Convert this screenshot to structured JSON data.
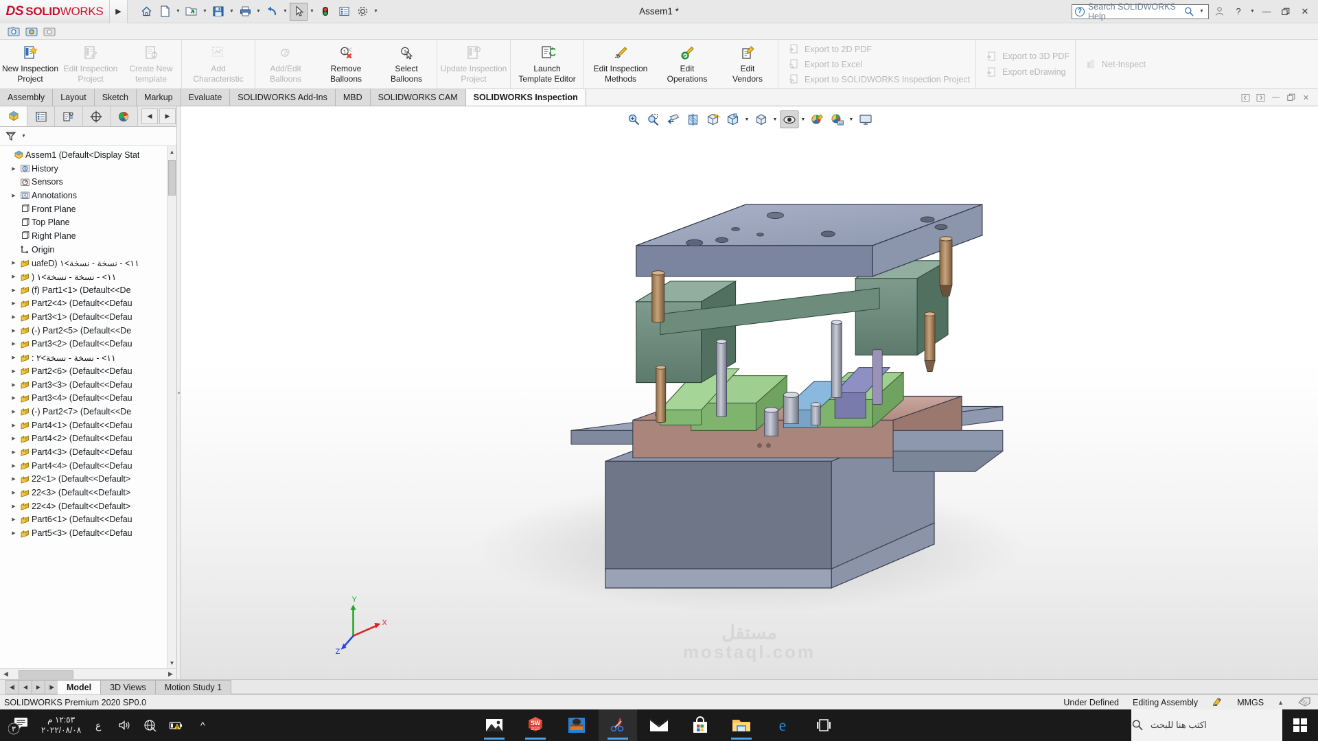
{
  "titlebar": {
    "brand_ds": "DS",
    "brand_solid": "SOLID",
    "brand_works": "WORKS",
    "document_title": "Assem1 *",
    "search_placeholder": "Search SOLIDWORKS Help",
    "tools": [
      "home-icon",
      "new-document-icon",
      "open-folder-icon",
      "save-icon",
      "print-icon",
      "undo-icon",
      "select-cursor-icon",
      "rebuild-icon",
      "options-list-icon",
      "settings-gear-icon"
    ],
    "window_buttons": [
      "account-icon",
      "help-icon",
      "minimize",
      "restore",
      "close"
    ]
  },
  "ribbon": {
    "groups": [
      {
        "buttons": [
          {
            "label_line1": "New Inspection",
            "label_line2": "Project",
            "icon": "new-inspection-project-icon",
            "disabled": false
          },
          {
            "label_line1": "Edit Inspection",
            "label_line2": "Project",
            "icon": "edit-inspection-project-icon",
            "disabled": true
          },
          {
            "label_line1": "Create New",
            "label_line2": "template",
            "icon": "create-new-template-icon",
            "disabled": true
          }
        ]
      },
      {
        "buttons": [
          {
            "label_line1": "Add",
            "label_line2": "Characteristic",
            "icon": "add-characteristic-icon",
            "disabled": true
          }
        ]
      },
      {
        "buttons": [
          {
            "label_line1": "Add/Edit",
            "label_line2": "Balloons",
            "icon": "add-edit-balloons-icon",
            "disabled": true
          },
          {
            "label_line1": "Remove",
            "label_line2": "Balloons",
            "icon": "remove-balloons-icon",
            "disabled": false
          },
          {
            "label_line1": "Select",
            "label_line2": "Balloons",
            "icon": "select-balloons-icon",
            "disabled": false
          }
        ]
      },
      {
        "buttons": [
          {
            "label_line1": "Update Inspection",
            "label_line2": "Project",
            "icon": "update-inspection-project-icon",
            "disabled": true
          }
        ]
      },
      {
        "buttons": [
          {
            "label_line1": "Launch",
            "label_line2": "Template Editor",
            "icon": "launch-template-editor-icon",
            "disabled": false
          }
        ]
      },
      {
        "buttons": [
          {
            "label_line1": "Edit Inspection",
            "label_line2": "Methods",
            "icon": "edit-inspection-methods-icon",
            "disabled": false
          },
          {
            "label_line1": "Edit",
            "label_line2": "Operations",
            "icon": "edit-operations-icon",
            "disabled": false
          },
          {
            "label_line1": "Edit",
            "label_line2": "Vendors",
            "icon": "edit-vendors-icon",
            "disabled": false
          }
        ]
      }
    ],
    "export_list_1": [
      {
        "label": "Export to 2D PDF",
        "icon": "export-pdf-icon"
      },
      {
        "label": "Export to Excel",
        "icon": "export-excel-icon"
      },
      {
        "label": "Export to SOLIDWORKS Inspection Project",
        "icon": "export-swi-icon"
      }
    ],
    "export_list_2": [
      {
        "label": "Export to 3D PDF",
        "icon": "export-3dpdf-icon"
      },
      {
        "label": "Export eDrawing",
        "icon": "export-edrawing-icon"
      }
    ],
    "export_list_3": [
      {
        "label": "Net-Inspect",
        "icon": "net-inspect-icon"
      }
    ]
  },
  "command_tabs": {
    "items": [
      "Assembly",
      "Layout",
      "Sketch",
      "Markup",
      "Evaluate",
      "SOLIDWORKS Add-Ins",
      "MBD",
      "SOLIDWORKS CAM",
      "SOLIDWORKS Inspection"
    ],
    "active": "SOLIDWORKS Inspection"
  },
  "feature_manager": {
    "tabs": [
      "feature-tree-icon",
      "property-manager-icon",
      "configuration-manager-icon",
      "dimxpert-icon",
      "display-manager-icon"
    ],
    "active_tab_index": 0,
    "filter_icon": "filter-icon",
    "tree": [
      {
        "label": "Assem1  (Default<Display Stat",
        "icon": "assembly-icon",
        "expand": false,
        "indent": 0,
        "rtl": false
      },
      {
        "label": "History",
        "icon": "history-icon",
        "expand": true,
        "indent": 1,
        "rtl": false
      },
      {
        "label": "Sensors",
        "icon": "sensors-icon",
        "expand": false,
        "indent": 1,
        "rtl": false
      },
      {
        "label": "Annotations",
        "icon": "annotations-icon",
        "expand": true,
        "indent": 1,
        "rtl": false
      },
      {
        "label": "Front Plane",
        "icon": "plane-icon",
        "expand": false,
        "indent": 1,
        "rtl": false
      },
      {
        "label": "Top Plane",
        "icon": "plane-icon",
        "expand": false,
        "indent": 1,
        "rtl": false
      },
      {
        "label": "Right Plane",
        "icon": "plane-icon",
        "expand": false,
        "indent": 1,
        "rtl": false
      },
      {
        "label": "Origin",
        "icon": "origin-icon",
        "expand": false,
        "indent": 1,
        "rtl": false
      },
      {
        "label": "١١> - نسخة - نسخة>١ (Defau",
        "icon": "part-icon",
        "expand": true,
        "indent": 1,
        "rtl": true
      },
      {
        "label": "١١> - نسخة - نسخة>١ (",
        "icon": "part-icon",
        "expand": true,
        "indent": 1,
        "rtl": true
      },
      {
        "label": "(f) Part1<1> (Default<<De",
        "icon": "part-icon",
        "expand": true,
        "indent": 1,
        "rtl": false
      },
      {
        "label": "Part2<4> (Default<<Defau",
        "icon": "part-icon",
        "expand": true,
        "indent": 1,
        "rtl": false
      },
      {
        "label": "Part3<1> (Default<<Defau",
        "icon": "part-icon",
        "expand": true,
        "indent": 1,
        "rtl": false
      },
      {
        "label": "(-) Part2<5> (Default<<De",
        "icon": "part-icon",
        "expand": true,
        "indent": 1,
        "rtl": false
      },
      {
        "label": "Part3<2> (Default<<Defau",
        "icon": "part-icon",
        "expand": true,
        "indent": 1,
        "rtl": false
      },
      {
        "label": "١١> - نسخة - نسخة>٢ :",
        "icon": "part-icon",
        "expand": true,
        "indent": 1,
        "rtl": true
      },
      {
        "label": "Part2<6> (Default<<Defau",
        "icon": "part-icon",
        "expand": true,
        "indent": 1,
        "rtl": false
      },
      {
        "label": "Part3<3> (Default<<Defau",
        "icon": "part-icon",
        "expand": true,
        "indent": 1,
        "rtl": false
      },
      {
        "label": "Part3<4> (Default<<Defau",
        "icon": "part-icon",
        "expand": true,
        "indent": 1,
        "rtl": false
      },
      {
        "label": "(-) Part2<7> (Default<<De",
        "icon": "part-icon",
        "expand": true,
        "indent": 1,
        "rtl": false
      },
      {
        "label": "Part4<1> (Default<<Defau",
        "icon": "part-icon",
        "expand": true,
        "indent": 1,
        "rtl": false
      },
      {
        "label": "Part4<2> (Default<<Defau",
        "icon": "part-icon",
        "expand": true,
        "indent": 1,
        "rtl": false
      },
      {
        "label": "Part4<3> (Default<<Defau",
        "icon": "part-icon",
        "expand": true,
        "indent": 1,
        "rtl": false
      },
      {
        "label": "Part4<4> (Default<<Defau",
        "icon": "part-icon",
        "expand": true,
        "indent": 1,
        "rtl": false
      },
      {
        "label": "22<1> (Default<<Default>",
        "icon": "part-icon",
        "expand": true,
        "indent": 1,
        "rtl": false
      },
      {
        "label": "22<3> (Default<<Default>",
        "icon": "part-icon",
        "expand": true,
        "indent": 1,
        "rtl": false
      },
      {
        "label": "22<4> (Default<<Default>",
        "icon": "part-icon",
        "expand": true,
        "indent": 1,
        "rtl": false
      },
      {
        "label": "Part6<1> (Default<<Defau",
        "icon": "part-icon",
        "expand": true,
        "indent": 1,
        "rtl": false
      },
      {
        "label": "Part5<3> (Default<<Defau",
        "icon": "part-icon",
        "expand": true,
        "indent": 1,
        "rtl": false
      }
    ]
  },
  "view_toolbar": {
    "buttons": [
      "zoom-to-fit-icon",
      "zoom-to-area-icon",
      "previous-view-icon",
      "section-view-icon",
      "view-orientation-icon",
      "display-style-icon",
      "hide-show-items-icon",
      "edit-appearance-icon",
      "apply-scene-icon",
      "view-settings-icon"
    ]
  },
  "graphics": {
    "triad_labels": {
      "x": "X",
      "y": "Y",
      "z": "Z"
    },
    "watermark_line1": "مستقل",
    "watermark_line2": "mostaql.com"
  },
  "bottom_tabs": {
    "nav_buttons": [
      "first-icon",
      "previous-icon",
      "next-icon",
      "last-icon"
    ],
    "items": [
      "Model",
      "3D Views",
      "Motion Study 1"
    ],
    "active": "Model"
  },
  "status_bar": {
    "left": "SOLIDWORKS Premium 2020 SP0.0",
    "state": "Under Defined",
    "mode": "Editing Assembly",
    "mode_icon": "editing-assembly-icon",
    "units": "MMGS",
    "units_caret": "▲",
    "overlay_icon": "tags-icon"
  },
  "taskbar": {
    "notification_count": "٣",
    "clock_time": "١٢:٥٣ م",
    "clock_date": "٢٠٢٢/٠٨/٠٨",
    "lang": "ع",
    "tray": [
      "volume-icon",
      "network-offline-icon",
      "battery-warning-icon",
      "show-hidden-icons-icon"
    ],
    "apps": [
      {
        "name": "photos-app-icon",
        "active": false,
        "running": true
      },
      {
        "name": "solidworks-2020-icon",
        "active": false,
        "running": true,
        "badge": "2020"
      },
      {
        "name": "media-app-icon",
        "active": false,
        "running": false
      },
      {
        "name": "snip-sketch-icon",
        "active": true,
        "running": true
      },
      {
        "name": "mail-icon",
        "active": false,
        "running": false
      },
      {
        "name": "microsoft-store-icon",
        "active": false,
        "running": false
      },
      {
        "name": "file-explorer-icon",
        "active": false,
        "running": true
      },
      {
        "name": "microsoft-edge-icon",
        "active": false,
        "running": false
      },
      {
        "name": "task-view-icon",
        "active": false,
        "running": false
      }
    ],
    "search_placeholder": "اكتب هنا للبحث",
    "start_icon": "windows-start-icon"
  }
}
